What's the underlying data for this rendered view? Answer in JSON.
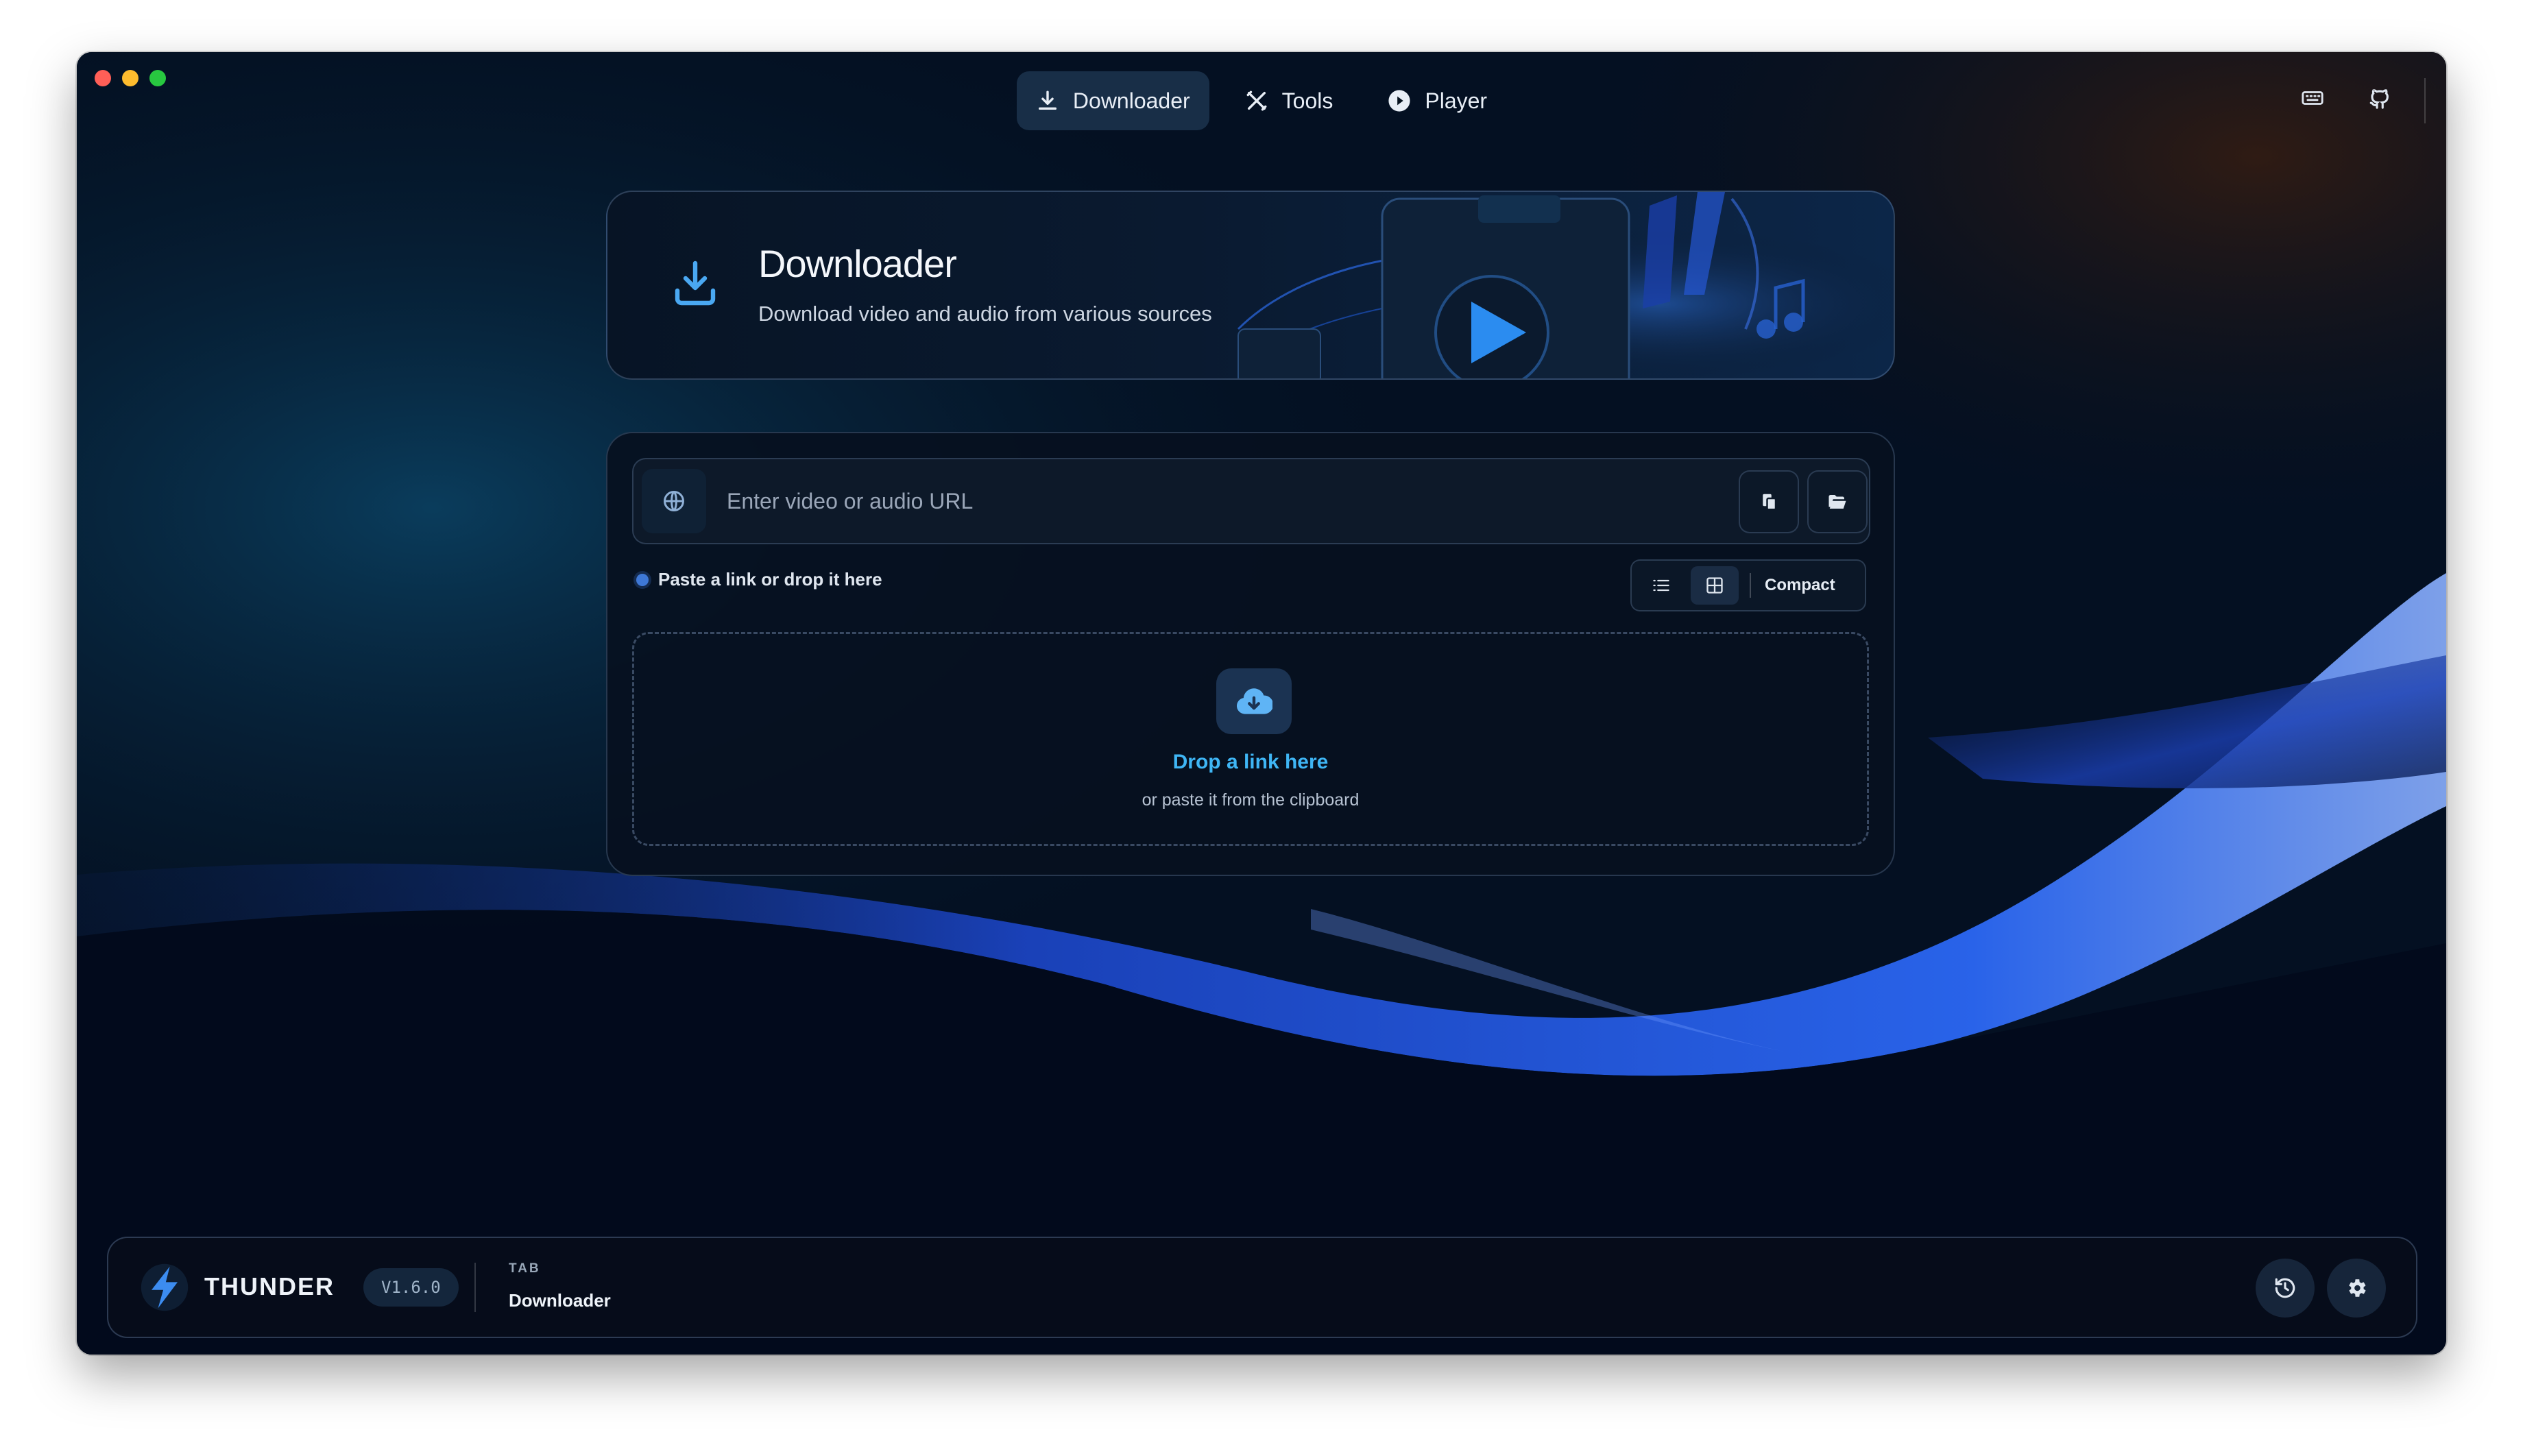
{
  "nav": {
    "tabs": [
      {
        "label": "Downloader",
        "icon": "download-icon",
        "active": true
      },
      {
        "label": "Tools",
        "icon": "tools-icon",
        "active": false
      },
      {
        "label": "Player",
        "icon": "play-circle-icon",
        "active": false
      }
    ],
    "right_icons": [
      "keyboard-icon",
      "github-icon"
    ]
  },
  "hero": {
    "title": "Downloader",
    "subtitle": "Download video and audio from various sources"
  },
  "url_bar": {
    "placeholder": "Enter video or audio URL",
    "value": ""
  },
  "hint": {
    "text": "Paste a link or drop it here"
  },
  "view_toggle": {
    "options": [
      "list-view-icon",
      "grid-view-icon"
    ],
    "active": "grid-view-icon",
    "label": "Compact"
  },
  "dropzone": {
    "title": "Drop a link here",
    "subtitle": "or paste it from the clipboard"
  },
  "footer": {
    "brand": "THUNDER",
    "version": "V1.6.0",
    "tab_label": "TAB",
    "tab_value": "Downloader"
  },
  "colors": {
    "accent": "#3fb6f5",
    "background": "#04101f",
    "wave": "#1f4fd8"
  }
}
